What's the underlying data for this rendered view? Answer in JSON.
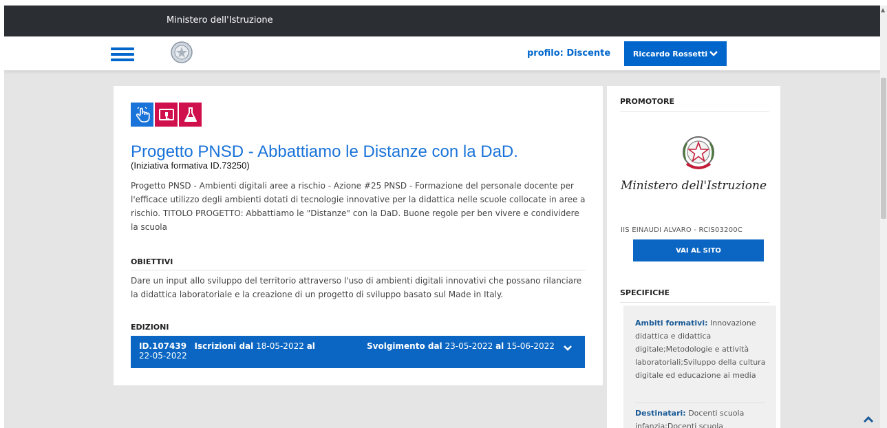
{
  "topbar": {
    "ministry": "Ministero dell'Istruzione"
  },
  "header": {
    "profile_label": "profilo: Discente",
    "user_name": "Riccardo Rossetti"
  },
  "main": {
    "icons": [
      "hand-pointer-icon",
      "tablet-touch-icon",
      "flask-icon"
    ],
    "title": "Progetto PNSD - Abbattiamo le Distanze con la DaD.",
    "subtitle": "(Iniziativa formativa ID.73250)",
    "description": "Progetto PNSD - Ambienti digitali aree a rischio - Azione #25 PNSD - Formazione del personale docente per l'efficace utilizzo degli ambienti dotati di tecnologie innovative per la didattica nelle scuole collocate in aree a rischio. TITOLO PROGETTO: Abbattiamo le \"Distanze\" con la DaD. Buone regole per ben vivere e condividere la scuola",
    "obiettivi_heading": "OBIETTIVI",
    "obiettivi_text": "Dare un input allo sviluppo del territorio attraverso l'uso di ambienti digitali innovativi che possano rilanciare la didattica laboratoriale e la creazione di un progetto di sviluppo basato sul Made in Italy.",
    "edizioni_heading": "EDIZIONI",
    "edition": {
      "id": "ID.107439",
      "iscrizioni_label": "Iscrizioni dal",
      "iscrizioni_from": "18-05-2022",
      "al1": "al",
      "iscrizioni_to": "22-05-2022",
      "svolgimento_label": "Svolgimento dal",
      "svolgimento_from": "23-05-2022",
      "al2": "al",
      "svolgimento_to": "15-06-2022"
    }
  },
  "sidebar": {
    "promotore_heading": "PROMOTORE",
    "logo_text": "Ministero dell'Istruzione",
    "school": "IIS EINAUDI ALVARO - RCIS03200C",
    "site_button": "VAI AL SITO",
    "specifiche_heading": "SPECIFICHE",
    "specs": [
      {
        "label": "Ambiti formativi:",
        "value": "Innovazione didattica e didattica digitale;Metodologie e attività laboratoriali;Sviluppo della cultura digitale ed educazione ai media"
      },
      {
        "label": "Destinatari:",
        "value": "Docenti scuola infanzia;Docenti scuola"
      }
    ]
  },
  "colors": {
    "accent": "#0066cc",
    "topbar": "#2b2e33",
    "badge_red": "#d0104d",
    "background": "#e5e5e5"
  }
}
